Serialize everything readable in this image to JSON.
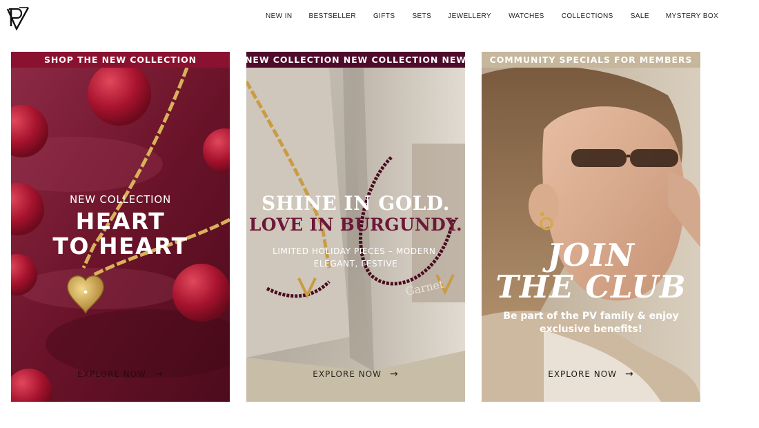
{
  "header": {
    "logo_text": "PV",
    "nav": [
      "NEW IN",
      "BESTSELLER",
      "GIFTS",
      "SETS",
      "JEWELLERY",
      "WATCHES",
      "COLLECTIONS",
      "SALE",
      "MYSTERY BOX"
    ]
  },
  "cards": [
    {
      "banner": "SHOP THE NEW COLLECTION",
      "kicker": "NEW COLLECTION",
      "headline": "HEART\nTO HEART",
      "cta": "EXPLORE NOW",
      "banner_color": "#8a1230"
    },
    {
      "banner": "NEW COLLECTION NEW COLLECTION NEW",
      "headline_1": "SHINE IN GOLD.",
      "headline_2": "LOVE IN BURGUNDY.",
      "subtext": "LIMITED HOLIDAY PIECES – MODERN, ELEGANT, FESTIVE",
      "cta": "EXPLORE NOW",
      "banner_color": "#4e0b2b",
      "accent_color": "#6d1838"
    },
    {
      "banner": "COMMUNITY SPECIALS FOR MEMBERS",
      "headline": "JOIN\nTHE CLUB",
      "subtext": "Be part of the PV family & enjoy exclusive benefits!",
      "cta": "EXPLORE NOW",
      "banner_color": "#c5b69c"
    }
  ],
  "icons": {
    "cta_arrow": "arrow-right-icon"
  }
}
